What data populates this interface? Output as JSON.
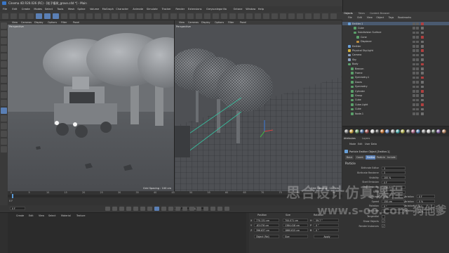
{
  "titlebar": {
    "title": "Cinema 4D R20.026 (RC) - [粒子植树_grove.c4d *] - Main"
  },
  "menubar": {
    "items": [
      "File",
      "Edit",
      "Create",
      "Modes",
      "Select",
      "Tools",
      "Mesh",
      "Spline",
      "Volume",
      "MoGraph",
      "Character",
      "Animate",
      "Simulate",
      "Tracker",
      "Render",
      "Extensions",
      "Greyscalegorilla",
      "Octane",
      "Window",
      "Help"
    ],
    "layout_label": "Layout:",
    "layout_value": "Octane Fast"
  },
  "viewport_left": {
    "menu": [
      "View",
      "Cameras",
      "Display",
      "Options",
      "Filter",
      "Panel"
    ],
    "label": "Perspective",
    "grid_spacing": "Grid Spacing : 100 cm"
  },
  "viewport_right": {
    "menu": [
      "View",
      "Cameras",
      "Display",
      "Options",
      "Filter",
      "Panel"
    ],
    "label": "Perspective",
    "grid_spacing": "Grid Spacing : 100 cm"
  },
  "timeline": {
    "ticks": [
      "0",
      "5",
      "10",
      "15",
      "20",
      "25",
      "30",
      "35",
      "40",
      "45",
      "50",
      "55",
      "60",
      "65",
      "70",
      "75",
      "80",
      "85",
      "90"
    ],
    "current": "0 F",
    "frame_start": "0 F",
    "frame_end": "90 F",
    "frame_end2": "90 F"
  },
  "material": {
    "menu": [
      "Create",
      "Edit",
      "View",
      "Select",
      "Material",
      "Texture"
    ]
  },
  "coords": {
    "headers": [
      "Position",
      "Size",
      "Rotation"
    ],
    "x_pos": "770.131 cm",
    "y_pos": "-63.076 cm",
    "z_pos": "396.637 cm",
    "x_size": "700.071 cm",
    "y_size": "1384.418 cm",
    "z_size": "1860.615 cm",
    "h_rot": "59.7 °",
    "p_rot": "0 °",
    "b_rot": "0 °",
    "mode": "Object (Rel)",
    "size_mode": "Size",
    "apply": "Apply"
  },
  "objects": {
    "tabs": [
      "Objects",
      "Takes",
      "Content Browser"
    ],
    "menu": [
      "File",
      "Edit",
      "View",
      "Object",
      "Tags",
      "Bookmarks"
    ],
    "rows": [
      {
        "name": "Emitter.1",
        "indent": 2,
        "color": "#6aa0d8"
      },
      {
        "name": "Cube",
        "indent": 4,
        "color": "#5aa06a"
      },
      {
        "name": "Subdivision Surface",
        "indent": 4,
        "color": "#5aa06a"
      },
      {
        "name": "Cone",
        "indent": 5,
        "color": "#5aa06a"
      },
      {
        "name": "Displacer",
        "indent": 5,
        "color": "#c09040"
      },
      {
        "name": "Emitter",
        "indent": 2,
        "color": "#6aa0d8"
      },
      {
        "name": "Physical Sky.Light",
        "indent": 2,
        "color": "#d0b040"
      },
      {
        "name": "Camera",
        "indent": 2,
        "color": "#8aa0c0"
      },
      {
        "name": "Sky",
        "indent": 2,
        "color": "#8aa0c0"
      },
      {
        "name": "Body",
        "indent": 2,
        "color": "#5aa06a"
      },
      {
        "name": "Beacon",
        "indent": 3,
        "color": "#5aa06a"
      },
      {
        "name": "Frame",
        "indent": 3,
        "color": "#5aa06a"
      },
      {
        "name": "Symmetry.1",
        "indent": 3,
        "color": "#5aa06a"
      },
      {
        "name": "Doors",
        "indent": 3,
        "color": "#5aa06a"
      },
      {
        "name": "Symmetry",
        "indent": 3,
        "color": "#5aa06a"
      },
      {
        "name": "Cylinder",
        "indent": 3,
        "color": "#5aa06a"
      },
      {
        "name": "Group",
        "indent": 3,
        "color": "#5aa06a"
      },
      {
        "name": "Cube",
        "indent": 3,
        "color": "#5aa06a"
      },
      {
        "name": "Cube.Light",
        "indent": 3,
        "color": "#5aa06a"
      },
      {
        "name": "Cube",
        "indent": 3,
        "color": "#5aa06a"
      },
      {
        "name": "Node.1",
        "indent": 3,
        "color": "#5aa06a"
      }
    ]
  },
  "attributes": {
    "tabs": [
      "Attributes",
      "Layers"
    ],
    "menu": [
      "Mode",
      "Edit",
      "User Data"
    ],
    "object_title": "Particle Emitter Object [Emitter.1]",
    "subtabs": [
      "Basic",
      "Coord.",
      "Emitter",
      "Particle",
      "Include"
    ],
    "section": "Particle",
    "props": [
      {
        "label": "Birthrate Editor",
        "value": "3"
      },
      {
        "label": "Birthrate Renderer",
        "value": "3"
      },
      {
        "label": "Visibility",
        "value": "100 %"
      },
      {
        "label": "Start Emission",
        "value": "0 F"
      },
      {
        "label": "Stop Emission",
        "value": "150 F"
      },
      {
        "label": "Seed",
        "value": "0"
      },
      {
        "label": "Lifetime",
        "value": "600 F"
      },
      {
        "label": "Speed",
        "value": "150 cm"
      },
      {
        "label": "Rotation",
        "value": "0 °"
      },
      {
        "label": "End Scale",
        "value": "1"
      }
    ],
    "variations": [
      {
        "label": "Variation",
        "value": "0 F"
      },
      {
        "label": "Variation",
        "value": "0 %"
      },
      {
        "label": "Variation",
        "value": "0 °"
      },
      {
        "label": "Variation",
        "value": "0 %"
      }
    ],
    "checks": [
      {
        "label": "Tangential",
        "value": ""
      },
      {
        "label": "Show Objects",
        "value": "✓"
      },
      {
        "label": "Render Instances",
        "value": "✓"
      }
    ]
  },
  "watermark": {
    "line1": "思合设计仿真课程",
    "line2": "www.s-oo.com 狗他爹"
  }
}
